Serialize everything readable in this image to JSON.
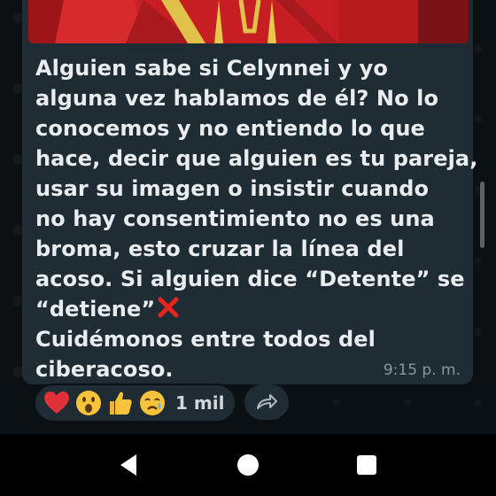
{
  "message": {
    "lines": [
      "Alguien sabe si Celynnei y yo",
      "alguna vez hablamos de él? No lo",
      "conocemos y no entiendo lo que",
      "hace, decir que alguien es tu pareja,",
      "usar su imagen o insistir cuando",
      "no hay consentimiento no es una",
      "broma, esto cruzar la línea del",
      "acoso. Si alguien dice “Detente” se",
      "“detiene”",
      "Cuidémonos entre todos del",
      "ciberacoso."
    ],
    "time": "9:15 p. m."
  },
  "reactions": {
    "emojis": [
      "red-heart",
      "face-with-open-mouth",
      "thumbs-up",
      "sad-but-relieved-face"
    ],
    "count": "1 mil"
  },
  "colors": {
    "background": "#0b1014",
    "bubble": "#1f2c34",
    "text": "#e9edef",
    "timestamp": "#8696a0",
    "media": "#c61e22"
  }
}
